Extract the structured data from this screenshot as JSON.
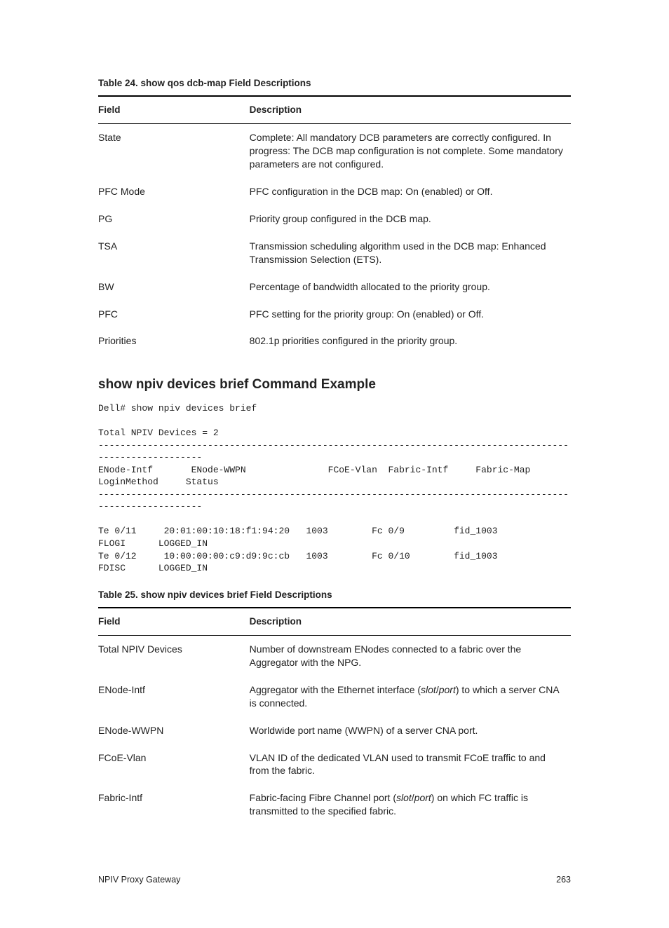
{
  "table24": {
    "caption": "Table 24. show qos dcb-map Field Descriptions",
    "headers": {
      "field": "Field",
      "desc": "Description"
    },
    "rows": [
      {
        "field": "State",
        "desc": "Complete: All mandatory DCB parameters are correctly configured. In progress: The DCB map configuration is not complete. Some mandatory parameters are not configured."
      },
      {
        "field": "PFC Mode",
        "desc": "PFC configuration in the DCB map: On (enabled) or Off."
      },
      {
        "field": "PG",
        "desc": "Priority group configured in the DCB map."
      },
      {
        "field": "TSA",
        "desc": "Transmission scheduling algorithm used in the DCB map: Enhanced Transmission Selection (ETS)."
      },
      {
        "field": "BW",
        "desc": "Percentage of bandwidth allocated to the priority group."
      },
      {
        "field": "PFC",
        "desc": "PFC setting for the priority group: On (enabled) or Off."
      },
      {
        "field": "Priorities",
        "desc": "802.1p priorities configured in the priority group."
      }
    ]
  },
  "section_heading": "show npiv devices brief Command Example",
  "code_block": "Dell# show npiv devices brief\n\nTotal NPIV Devices = 2\n---------------------------------------------------------------------------------------------------------\nENode-Intf       ENode-WWPN               FCoE-Vlan  Fabric-Intf     Fabric-Map     LoginMethod     Status\n---------------------------------------------------------------------------------------------------------\n\nTe 0/11     20:01:00:10:18:f1:94:20   1003        Fc 0/9         fid_1003         FLOGI      LOGGED_IN\nTe 0/12     10:00:00:00:c9:d9:9c:cb   1003        Fc 0/10        fid_1003         FDISC      LOGGED_IN",
  "table25": {
    "caption": "Table 25. show npiv devices brief Field Descriptions",
    "headers": {
      "field": "Field",
      "desc": "Description"
    },
    "rows": [
      {
        "field": "Total NPIV Devices",
        "desc": "Number of downstream ENodes connected to a fabric over the Aggregator with the NPG."
      },
      {
        "field": "ENode-Intf",
        "desc_pre": "Aggregator with the Ethernet interface (",
        "desc_mid1": "slot",
        "desc_sep": "/",
        "desc_mid2": "port",
        "desc_post": ") to which a server CNA is connected."
      },
      {
        "field": "ENode-WWPN",
        "desc": "Worldwide port name (WWPN) of a server CNA port."
      },
      {
        "field": "FCoE-Vlan",
        "desc": "VLAN ID of the dedicated VLAN used to transmit FCoE traffic to and from the fabric."
      },
      {
        "field": "Fabric-Intf",
        "desc_pre": "Fabric-facing Fibre Channel port (",
        "desc_mid1": "slot",
        "desc_sep": "/",
        "desc_mid2": "port",
        "desc_post": ") on which FC traffic is transmitted to the specified fabric."
      }
    ]
  },
  "footer": {
    "left": "NPIV Proxy Gateway",
    "right": "263"
  }
}
